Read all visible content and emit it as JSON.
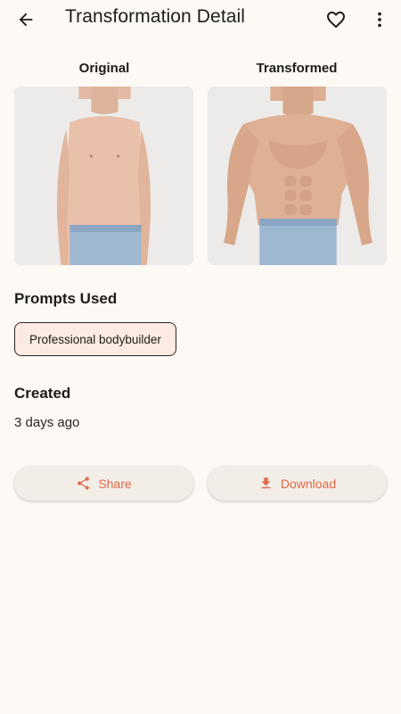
{
  "appbar": {
    "title": "Transformation Detail",
    "back_icon": "arrow-left-icon",
    "favorite_icon": "heart-outline-icon",
    "more_icon": "more-vert-icon"
  },
  "images": {
    "original_label": "Original",
    "transformed_label": "Transformed"
  },
  "prompts": {
    "title": "Prompts Used",
    "items": [
      "Professional bodybuilder"
    ]
  },
  "created": {
    "title": "Created",
    "value": "3 days ago"
  },
  "actions": {
    "share_label": "Share",
    "share_icon": "share-icon",
    "download_label": "Download",
    "download_icon": "download-icon"
  },
  "colors": {
    "background": "#fdf9f5",
    "accent": "#e0694a",
    "chip_bg": "#fcebe3",
    "button_bg": "#f3ede7"
  }
}
